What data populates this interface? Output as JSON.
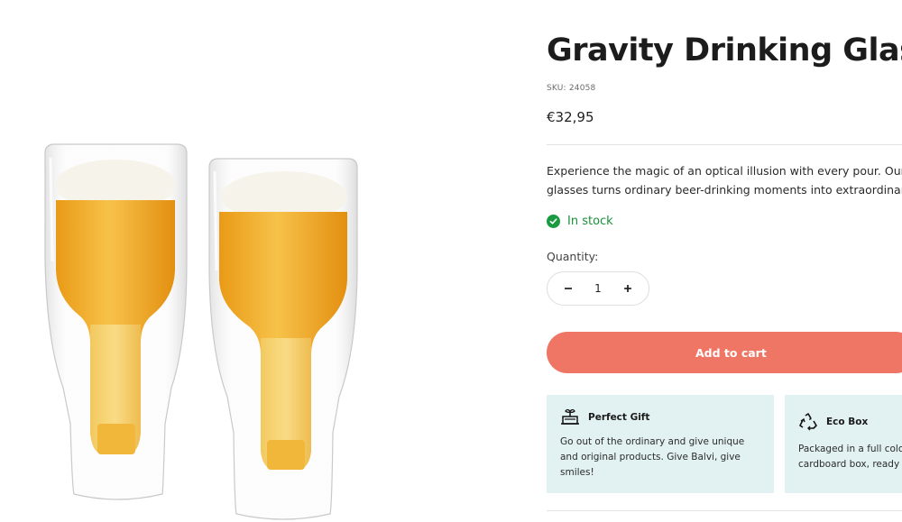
{
  "product": {
    "title": "Gravity Drinking Glass",
    "sku": "SKU: 24058",
    "price": "€32,95",
    "description_line1": "Experience the magic of an optical illusion with every pour. Our se",
    "description_line2": "glasses turns ordinary beer-drinking moments into extraordinary e",
    "stock_status": "In stock"
  },
  "quantity": {
    "label": "Quantity:",
    "value": "1"
  },
  "cart": {
    "add_label": "Add to cart"
  },
  "features": [
    {
      "title": "Perfect Gift",
      "icon": "gift-box-icon",
      "line1": "Go out of the ordinary and give unique",
      "line2": "and original products. Give Balvi, give",
      "line3": "smiles!"
    },
    {
      "title": "Eco Box",
      "icon": "recycle-icon",
      "line1": "Packaged in a full colo",
      "line2": "cardboard box, ready t"
    }
  ],
  "colors": {
    "accent": "#ef7565",
    "stock": "#1a9b41",
    "feature_bg": "#e2f1f1"
  }
}
